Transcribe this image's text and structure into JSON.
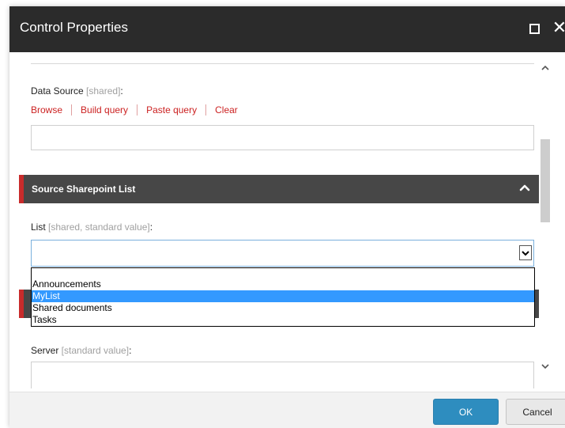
{
  "dialog": {
    "title": "Control Properties"
  },
  "data_source": {
    "label": "Data Source",
    "hint": " [shared]",
    "colon": ":",
    "links": [
      "Browse",
      "Build query",
      "Paste query",
      "Clear"
    ]
  },
  "section": {
    "title": "Source Sharepoint List"
  },
  "list_field": {
    "label": "List",
    "hint": " [shared, standard value]",
    "colon": ":",
    "selected_value": "",
    "options": [
      "Announcements",
      "MyList",
      "Shared documents",
      "Tasks"
    ],
    "highlighted_index": 1
  },
  "server_field": {
    "label": "Server",
    "hint": " [standard value]",
    "colon": ":"
  },
  "footer": {
    "ok_label": "OK",
    "cancel_label": "Cancel"
  },
  "icons": {
    "maximize": "maximize-icon",
    "close": "close-icon",
    "chevron_up": "chevron-up-icon",
    "chevron_down": "chevron-down-icon"
  },
  "colors": {
    "header_bg": "#2b2b2b",
    "accent_red": "#c82b2b",
    "link_red": "#cc2222",
    "ok_blue": "#2e8dbf",
    "selection_blue": "#3399ff"
  }
}
